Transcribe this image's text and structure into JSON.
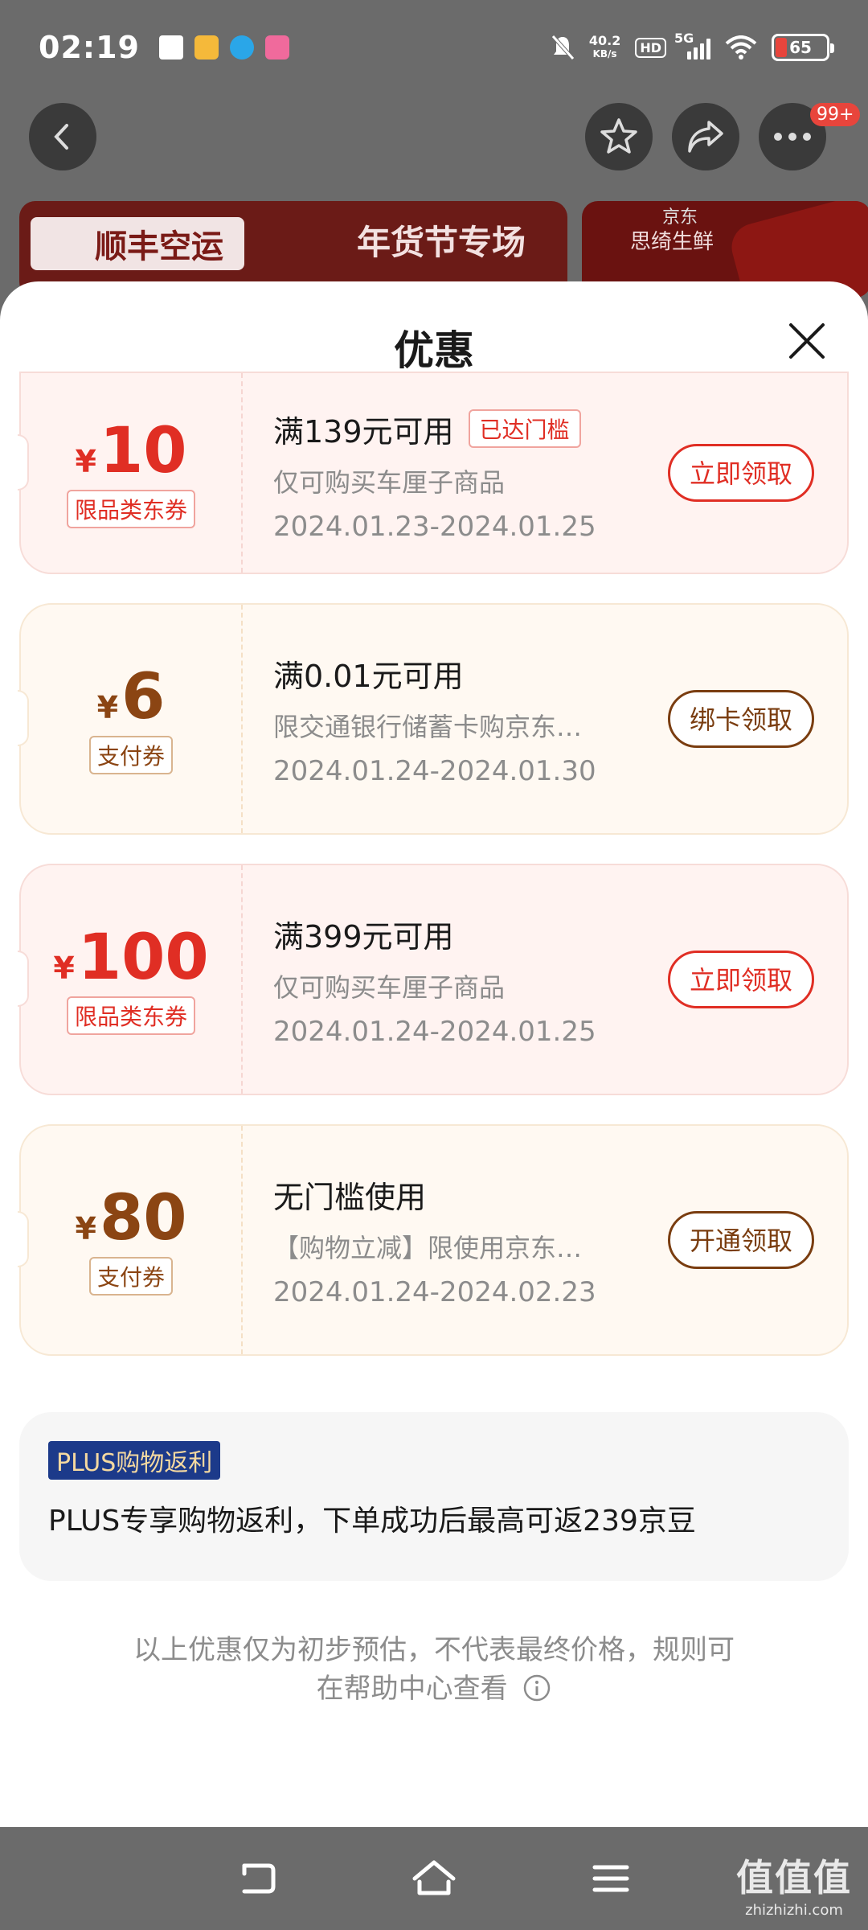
{
  "status_bar": {
    "time": "02:19",
    "net_speed_value": "40.2",
    "net_speed_unit": "KB/s",
    "hd": "HD",
    "network": "5G",
    "battery": "65"
  },
  "banners": {
    "left_brand": "顺丰空运",
    "left_title": "年货节专场",
    "right_line1": "京东",
    "right_line2": "思绮生鲜"
  },
  "top_nav": {
    "more_badge": "99+"
  },
  "sheet": {
    "title": "优惠"
  },
  "coupons": [
    {
      "currency": "¥",
      "amount": "10",
      "type_tag": "限品类东券",
      "condition": "满139元可用",
      "status_tag": "已达门槛",
      "scope": "仅可购买车厘子商品",
      "dates": "2024.01.23-2024.01.25",
      "action": "立即领取"
    },
    {
      "currency": "¥",
      "amount": "6",
      "type_tag": "支付券",
      "condition": "满0.01元可用",
      "scope": "限交通银行储蓄卡购京东…",
      "dates": "2024.01.24-2024.01.30",
      "action": "绑卡领取"
    },
    {
      "currency": "¥",
      "amount": "100",
      "type_tag": "限品类东券",
      "condition": "满399元可用",
      "scope": "仅可购买车厘子商品",
      "dates": "2024.01.24-2024.01.25",
      "action": "立即领取"
    },
    {
      "currency": "¥",
      "amount": "80",
      "type_tag": "支付券",
      "condition": "无门槛使用",
      "scope": "【购物立减】限使用京东…",
      "dates": "2024.01.24-2024.02.23",
      "action": "开通领取"
    }
  ],
  "plus": {
    "tag": "PLUS购物返利",
    "text": "PLUS专享购物返利，下单成功后最高可返239京豆"
  },
  "disclaimer": {
    "line1": "以上优惠仅为初步预估，不代表最终价格，规则可",
    "line2": "在帮助中心查看"
  },
  "watermark": {
    "big": "值值值",
    "small": "zhizhizhi.com"
  },
  "colors": {
    "coupon_red": "#e02e24",
    "coupon_gold": "#8b4513",
    "plus_tag_bg": "#1c3a8a"
  }
}
